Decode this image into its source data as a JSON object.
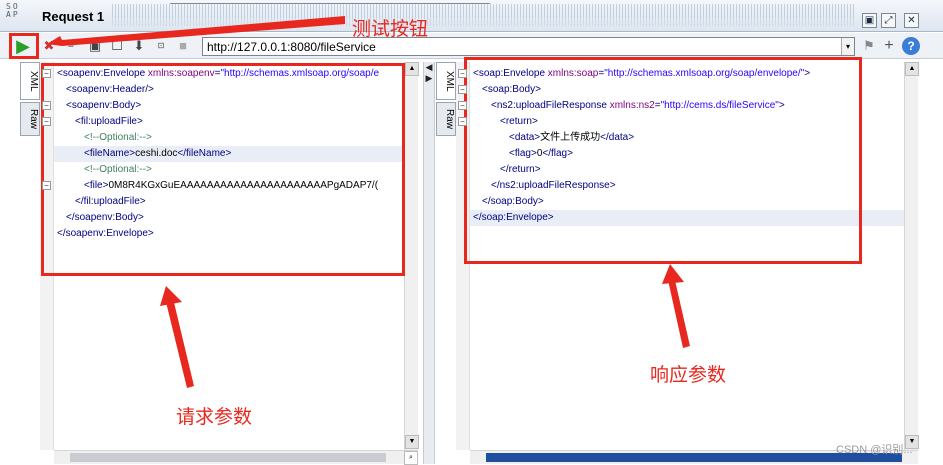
{
  "window": {
    "icon_label": "SO AP",
    "title": "Request 1",
    "controls": [
      "▣",
      "⤢",
      "✕"
    ]
  },
  "toolbar": {
    "url": "http://127.0.0.1:8080/fileService",
    "dropdown_glyph": "▾",
    "help_glyph": "?",
    "add_glyph": "+"
  },
  "request_pane": {
    "tabs": [
      "XML",
      "Raw"
    ],
    "lines": [
      {
        "indent": 0,
        "parts": [
          [
            "tag",
            "<soapenv:Envelope "
          ],
          [
            "attr",
            "xmlns:soapenv"
          ],
          [
            "tag",
            "="
          ],
          [
            "val",
            "\"http://schemas.xmlsoap.org/soap/e"
          ]
        ]
      },
      {
        "indent": 1,
        "parts": [
          [
            "tag",
            "<soapenv:Header/>"
          ]
        ]
      },
      {
        "indent": 1,
        "parts": [
          [
            "tag",
            "<soapenv:Body>"
          ]
        ]
      },
      {
        "indent": 2,
        "parts": [
          [
            "tag",
            "<fil:uploadFile>"
          ]
        ]
      },
      {
        "indent": 3,
        "parts": [
          [
            "cmt",
            "<!--Optional:-->"
          ]
        ]
      },
      {
        "indent": 3,
        "highlight": true,
        "parts": [
          [
            "tag",
            "<fileName>"
          ],
          [
            "txt",
            "ceshi.doc"
          ],
          [
            "tag",
            "</fileName>"
          ]
        ]
      },
      {
        "indent": 3,
        "parts": [
          [
            "cmt",
            "<!--Optional:-->"
          ]
        ]
      },
      {
        "indent": 3,
        "parts": [
          [
            "tag",
            "<file>"
          ],
          [
            "txt",
            "0M8R4KGxGuEAAAAAAAAAAAAAAAAAAAAAAPgADAP7/("
          ]
        ]
      },
      {
        "indent": 2,
        "parts": [
          [
            "tag",
            "</fil:uploadFile>"
          ]
        ]
      },
      {
        "indent": 1,
        "parts": [
          [
            "tag",
            "</soapenv:Body>"
          ]
        ]
      },
      {
        "indent": 0,
        "parts": [
          [
            "tag",
            "</soapenv:Envelope>"
          ]
        ]
      }
    ]
  },
  "response_pane": {
    "tabs": [
      "XML",
      "Raw"
    ],
    "lines": [
      {
        "indent": 0,
        "parts": [
          [
            "tag",
            "<soap:Envelope "
          ],
          [
            "attr",
            "xmlns:soap"
          ],
          [
            "tag",
            "="
          ],
          [
            "val",
            "\"http://schemas.xmlsoap.org/soap/envelope/\""
          ],
          [
            "tag",
            ">"
          ]
        ]
      },
      {
        "indent": 1,
        "parts": [
          [
            "tag",
            "<soap:Body>"
          ]
        ]
      },
      {
        "indent": 2,
        "parts": [
          [
            "tag",
            "<ns2:uploadFileResponse "
          ],
          [
            "attr",
            "xmlns:ns2"
          ],
          [
            "tag",
            "="
          ],
          [
            "val",
            "\"http://cems.ds/fileService\""
          ],
          [
            "tag",
            ">"
          ]
        ]
      },
      {
        "indent": 3,
        "parts": [
          [
            "tag",
            "<return>"
          ]
        ]
      },
      {
        "indent": 4,
        "parts": [
          [
            "tag",
            "<data>"
          ],
          [
            "txt",
            "文件上传成功"
          ],
          [
            "tag",
            "</data>"
          ]
        ]
      },
      {
        "indent": 4,
        "parts": [
          [
            "tag",
            "<flag>"
          ],
          [
            "txt",
            "0"
          ],
          [
            "tag",
            "</flag>"
          ]
        ]
      },
      {
        "indent": 3,
        "parts": [
          [
            "tag",
            "</return>"
          ]
        ]
      },
      {
        "indent": 2,
        "parts": [
          [
            "tag",
            "</ns2:uploadFileResponse>"
          ]
        ]
      },
      {
        "indent": 1,
        "parts": [
          [
            "tag",
            "</soap:Body>"
          ]
        ]
      },
      {
        "indent": 0,
        "highlight": true,
        "parts": [
          [
            "tag",
            "</soap:Envelope>"
          ]
        ]
      }
    ]
  },
  "annotations": {
    "test_button": "测试按钮",
    "request_params": "请求参数",
    "response_params": "响应参数",
    "color": "#e8281e"
  },
  "watermark": "CSDN @识别..."
}
